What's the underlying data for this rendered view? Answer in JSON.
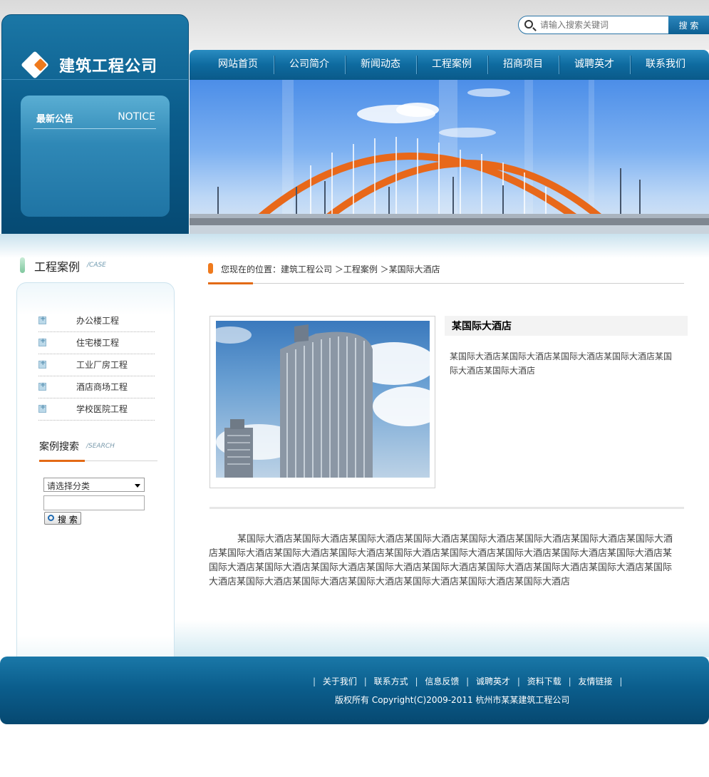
{
  "site": {
    "logo_text": "建筑工程公司"
  },
  "notice": {
    "title": "最新公告",
    "title_en": "NOTICE"
  },
  "search": {
    "placeholder": "请输入搜索关键词",
    "button_label": "搜 索"
  },
  "nav": {
    "items": [
      {
        "label": "网站首页"
      },
      {
        "label": "公司简介"
      },
      {
        "label": "新闻动态"
      },
      {
        "label": "工程案例"
      },
      {
        "label": "招商项目"
      },
      {
        "label": "诚聘英才"
      },
      {
        "label": "联系我们"
      }
    ]
  },
  "sidebar": {
    "title": "工程案例",
    "title_en": "/CASE",
    "categories": [
      {
        "label": "办公楼工程"
      },
      {
        "label": "住宅楼工程"
      },
      {
        "label": "工业厂房工程"
      },
      {
        "label": "酒店商场工程"
      },
      {
        "label": "学校医院工程"
      }
    ],
    "case_search": {
      "title": "案例搜索",
      "title_en": "/SEARCH",
      "select_value": "请选择分类",
      "button_label": "搜 索"
    }
  },
  "breadcrumb": {
    "text": "您现在的位置：建筑工程公司 ＞工程案例 ＞某国际大酒店"
  },
  "project": {
    "title": "某国际大酒店",
    "brief": "某国际大酒店某国际大酒店某国际大酒店某国际大酒店某国际大酒店某国际大酒店",
    "body": "某国际大酒店某国际大酒店某国际大酒店某国际大酒店某国际大酒店某国际大酒店某国际大酒店某国际大酒店某国际大酒店某国际大酒店某国际大酒店某国际大酒店某国际大酒店某国际大酒店某国际大酒店某国际大酒店某国际大酒店某国际大酒店某国际大酒店某国际大酒店某国际大酒店某国际大酒店某国际大酒店某国际大酒店某国际大酒店某国际大酒店某国际大酒店某国际大酒店某国际大酒店某国际大酒店某国际大酒店"
  },
  "footer": {
    "links": [
      {
        "label": "关于我们"
      },
      {
        "label": "联系方式"
      },
      {
        "label": "信息反馈"
      },
      {
        "label": "诚聘英才"
      },
      {
        "label": "资料下载"
      },
      {
        "label": "友情链接"
      }
    ],
    "copyright": "版权所有  Copyright(C)2009-2011 杭州市某某建筑工程公司"
  },
  "colors": {
    "brand_blue": "#0b5e8d",
    "accent_orange": "#e36a16"
  }
}
